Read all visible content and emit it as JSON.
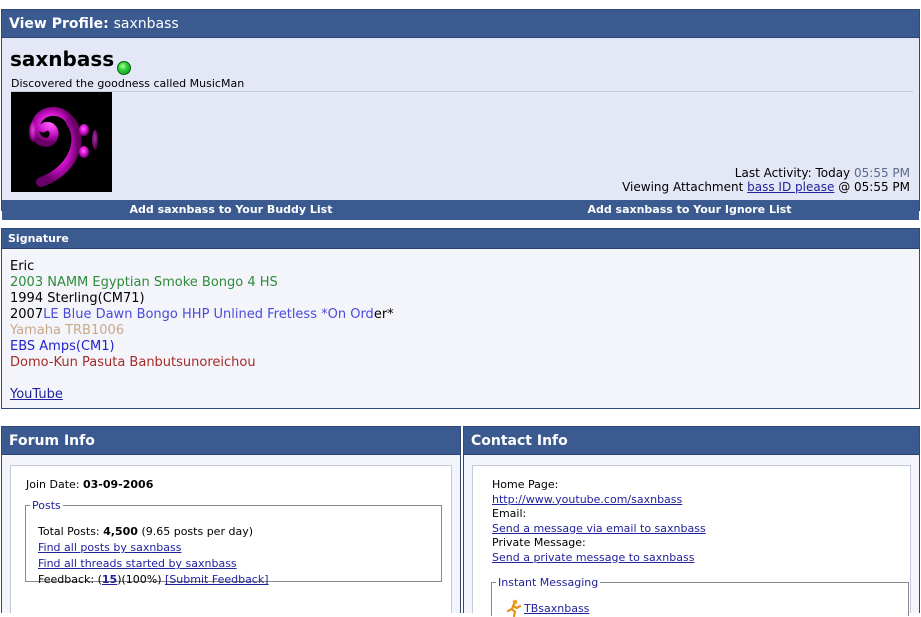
{
  "profile": {
    "header_label": "View Profile",
    "header_user": "saxnbass",
    "username": "saxnbass",
    "user_title": "Discovered the goodness called MusicMan",
    "last_activity_label": "Last Activity: Today",
    "last_activity_time": "05:55 PM",
    "viewing_prefix": "Viewing Attachment",
    "viewing_link": "bass ID please",
    "viewing_suffix": "@ 05:55 PM",
    "add_buddy": "Add saxnbass to Your Buddy List",
    "add_ignore": "Add saxnbass to Your Ignore List"
  },
  "signature": {
    "header": "Signature",
    "lines": [
      {
        "text": "Eric",
        "color": "#000000"
      },
      {
        "text": "2003 NAMM Egyptian Smoke Bongo 4 HS",
        "color": "#2e8b3a"
      },
      {
        "text": "1994 Sterling(CM71)",
        "color": "#000000"
      },
      {
        "text": "",
        "color": "#000000"
      },
      {
        "text": "Yamaha TRB1006",
        "color": "#c8a888"
      },
      {
        "text": "EBS Amps(CM1)",
        "color": "#2222cc"
      },
      {
        "text": "Domo-Kun Pasuta Banbutsunoreichou",
        "color": "#a52a2a"
      }
    ],
    "line4_a": "2007",
    "line4_b": "LE Blue Dawn Bongo HHP Unlined Fretless *On Ord",
    "line4_c": "er*",
    "youtube_link": "YouTube"
  },
  "forum_info": {
    "header": "Forum Info",
    "join_label": "Join Date:",
    "join_date": "03-09-2006",
    "posts_legend": "Posts",
    "total_posts_label": "Total Posts:",
    "total_posts": "4,500",
    "posts_per_day": "(9.65 posts per day)",
    "find_posts": "Find all posts by saxnbass",
    "find_threads": "Find all threads started by saxnbass",
    "feedback_label": "Feedback: (",
    "feedback_count": "15",
    "feedback_pct": ")(100%)",
    "submit_feedback": "[Submit Feedback]"
  },
  "contact_info": {
    "header": "Contact Info",
    "home_page_label": "Home Page:",
    "home_page_url": "http://www.youtube.com/saxnbass",
    "email_label": "Email:",
    "email_link": "Send a message via email to saxnbass",
    "pm_label": "Private Message:",
    "pm_link": "Send a private message to saxnbass",
    "im_legend": "Instant Messaging",
    "aim_name": "TBsaxnbass"
  },
  "colors": {
    "header_bar": "#3b5a8f",
    "link": "#22229c",
    "panel_bg": "#f4f5fb"
  }
}
